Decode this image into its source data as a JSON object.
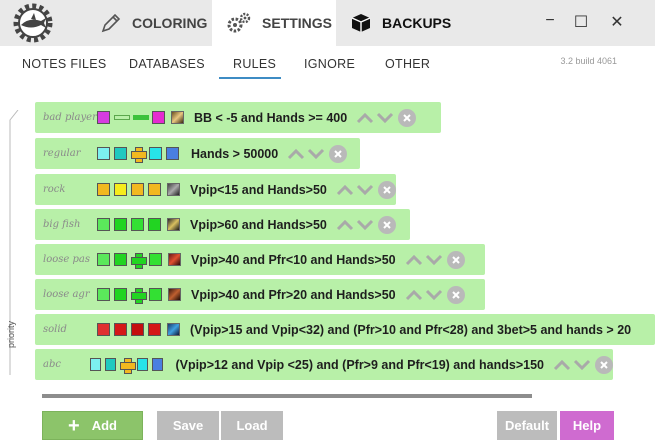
{
  "tabs": {
    "coloring": "COLORING",
    "settings": "SETTINGS",
    "backups": "BACKUPS"
  },
  "window_controls": {
    "minimize": "−",
    "maximize": "☐",
    "close": "✕"
  },
  "subtabs": [
    "NOTES FILES",
    "DATABASES",
    "RULES",
    "IGNORE",
    "OTHER"
  ],
  "active_subtab": "RULES",
  "version": "3.2 build 4061",
  "side_label": "priority",
  "rules": [
    {
      "name": "bad player",
      "condition": "BB < -5 and Hands >= 400"
    },
    {
      "name": "regular",
      "condition": "Hands > 50000"
    },
    {
      "name": "rock",
      "condition": "Vpip<15 and Hands>50"
    },
    {
      "name": "big fish",
      "condition": "Vpip>60 and Hands>50"
    },
    {
      "name": "loose pas",
      "condition": "Vpip>40 and Pfr<10 and Hands>50"
    },
    {
      "name": "loose agr",
      "condition": "Vpip>40 and Pfr>20 and Hands>50"
    },
    {
      "name": "solid",
      "condition": "(Vpip>15 and Vpip<32) and (Pfr>10 and Pfr<28) and 3bet>5 and hands > 20"
    },
    {
      "name": "abc",
      "condition": "(Vpip>12 and Vpip <25) and (Pfr>9 and Pfr<19) and hands>150"
    }
  ],
  "buttons": {
    "add": "Add",
    "save": "Save",
    "load": "Load",
    "default": "Default",
    "help": "Help"
  },
  "colors": {
    "rule_bg": "#b8f0a8",
    "accent": "#3e8cc4",
    "add_btn": "#8cc46a",
    "help_btn": "#cf6bd0",
    "neutral_btn": "#bcbcbc"
  }
}
